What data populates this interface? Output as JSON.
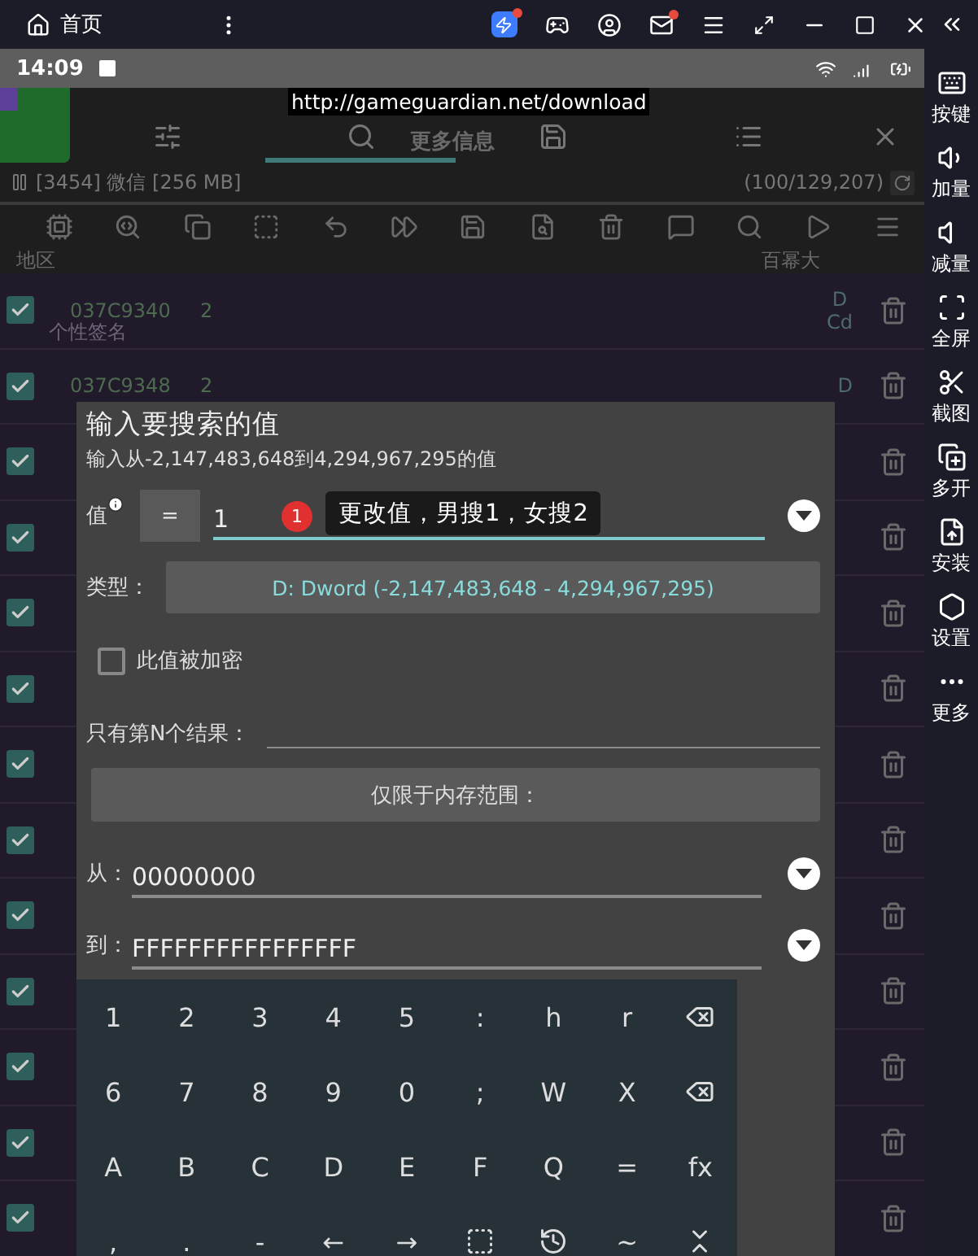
{
  "emulator_bar": {
    "home_label": "首页"
  },
  "status_bar": {
    "time": "14:09"
  },
  "app_header": {
    "tabs": [
      {
        "selected": false
      },
      {
        "selected": true
      },
      {
        "selected": false
      },
      {
        "selected": false
      }
    ],
    "tab_hint": "更多信息",
    "url": "http://gameguardian.net/download"
  },
  "process": {
    "label": "[3454] 微信 [256 MB]",
    "count": "(100/129,207)"
  },
  "columns": {
    "left": "地区",
    "right": "百幂大"
  },
  "results": [
    {
      "checked": true,
      "address": "037C9340",
      "value": "2",
      "type": "D",
      "flags": "Cd",
      "note": "个性签名"
    },
    {
      "checked": true,
      "address": "037C9348",
      "value": "2",
      "type": "D"
    },
    {
      "checked": true
    },
    {
      "checked": true
    },
    {
      "checked": true
    },
    {
      "checked": true
    },
    {
      "checked": true
    },
    {
      "checked": true
    },
    {
      "checked": true
    },
    {
      "checked": true
    },
    {
      "checked": true
    },
    {
      "checked": true
    },
    {
      "checked": true
    }
  ],
  "dialog": {
    "title": "输入要搜索的值",
    "subtitle": "输入从-2,147,483,648到4,294,967,295的值",
    "value_label": "值",
    "operator": "=",
    "value": "1",
    "badge": "1",
    "tooltip": "更改值，男搜1，女搜2",
    "type_label": "类型：",
    "type_value": "D: Dword (-2,147,483,648 - 4,294,967,295)",
    "encrypted": {
      "label": "此值被加密",
      "checked": false
    },
    "nth_label": "只有第N个结果：",
    "range_button": "仅限于内存范围：",
    "from_label": "从：",
    "from_value": "00000000",
    "to_label": "到：",
    "to_value": "FFFFFFFFFFFFFFFF",
    "keyboard": [
      [
        {
          "kind": "text",
          "label": "1"
        },
        {
          "kind": "text",
          "label": "2"
        },
        {
          "kind": "text",
          "label": "3"
        },
        {
          "kind": "text",
          "label": "4"
        },
        {
          "kind": "text",
          "label": "5"
        },
        {
          "kind": "text",
          "label": ":"
        },
        {
          "kind": "text",
          "label": "h"
        },
        {
          "kind": "text",
          "label": "r"
        },
        {
          "kind": "backspace"
        }
      ],
      [
        {
          "kind": "text",
          "label": "6"
        },
        {
          "kind": "text",
          "label": "7"
        },
        {
          "kind": "text",
          "label": "8"
        },
        {
          "kind": "text",
          "label": "9"
        },
        {
          "kind": "text",
          "label": "0"
        },
        {
          "kind": "text",
          "label": ";"
        },
        {
          "kind": "text",
          "label": "W"
        },
        {
          "kind": "text",
          "label": "X"
        },
        {
          "kind": "delete"
        }
      ],
      [
        {
          "kind": "text",
          "label": "A"
        },
        {
          "kind": "text",
          "label": "B"
        },
        {
          "kind": "text",
          "label": "C"
        },
        {
          "kind": "text",
          "label": "D"
        },
        {
          "kind": "text",
          "label": "E"
        },
        {
          "kind": "text",
          "label": "F"
        },
        {
          "kind": "text",
          "label": "Q"
        },
        {
          "kind": "text",
          "label": "="
        },
        {
          "kind": "text",
          "label": "fx"
        }
      ],
      [
        {
          "kind": "text",
          "label": ","
        },
        {
          "kind": "text",
          "label": "."
        },
        {
          "kind": "text",
          "label": "-"
        },
        {
          "kind": "text",
          "label": "←"
        },
        {
          "kind": "text",
          "label": "→"
        },
        {
          "kind": "select"
        },
        {
          "kind": "history"
        },
        {
          "kind": "text",
          "label": "~"
        },
        {
          "kind": "collapse"
        }
      ]
    ]
  },
  "sidebar": {
    "items": [
      {
        "label": "按键"
      },
      {
        "label": "加量"
      },
      {
        "label": "减量"
      },
      {
        "label": "全屏"
      },
      {
        "label": "截图"
      },
      {
        "label": "多开"
      },
      {
        "label": "安装"
      },
      {
        "label": "设置"
      },
      {
        "label": "更多"
      }
    ]
  }
}
